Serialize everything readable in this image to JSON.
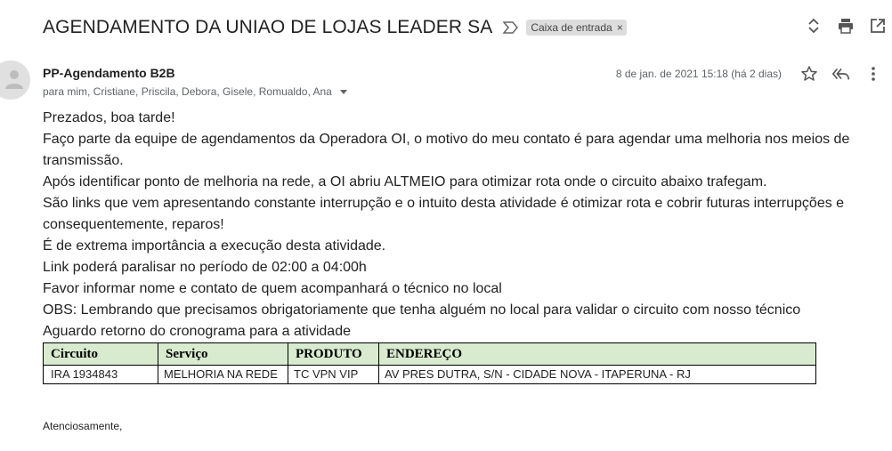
{
  "email": {
    "subject": "AGENDAMENTO DA UNIAO DE LOJAS LEADER SA",
    "label": "Caixa de entrada",
    "label_close": "×",
    "sender": "PP-Agendamento B2B",
    "recipients": "para mim, Cristiane, Priscila, Debora, Gisele, Romualdo, Ana",
    "date": "8 de jan. de 2021 15:18 (há 2 dias)"
  },
  "body": {
    "lines": [
      "Prezados, boa tarde!",
      "Faço parte da equipe de agendamentos  da Operadora OI, o motivo do meu contato é para agendar uma melhoria nos meios de transmissão.",
      "Após identificar ponto de melhoria na rede, a OI abriu ALTMEIO para otimizar rota onde o circuito abaixo trafegam.",
      "São links que vem apresentando constante interrupção e o intuito desta atividade é otimizar rota e cobrir futuras interrupções e consequentemente, reparos!",
      "É de extrema importância a execução desta atividade.",
      "Link poderá paralisar no período de 02:00 a 04:00h",
      "Favor informar nome e contato de quem acompanhará o técnico no local",
      "OBS: Lembrando que precisamos obrigatoriamente que tenha alguém no local para validar o circuito com nosso técnico",
      "Aguardo retorno do cronograma para a atividade"
    ]
  },
  "table": {
    "headers": [
      "Circuito",
      "Serviço",
      "PRODUTO",
      "ENDEREÇO"
    ],
    "row": {
      "circuito": "IRA 1934843",
      "servico": "MELHORIA NA REDE",
      "produto": "TC VPN VIP",
      "endereco": "AV PRES DUTRA, S/N  - CIDADE NOVA - ITAPERUNA - RJ"
    }
  },
  "signature": "Atenciosamente,",
  "icons": {
    "importance": "importance-marker-icon",
    "expand": "expand-collapse-icon",
    "print": "print-icon",
    "open_new": "open-in-new-window-icon",
    "star": "star-icon",
    "reply_all": "reply-all-icon",
    "more": "more-vert-icon",
    "avatar": "person-icon"
  },
  "colors": {
    "table_header_bg": "#d8ebcf",
    "label_bg": "#dddddd",
    "meta_text": "#5f6368"
  }
}
